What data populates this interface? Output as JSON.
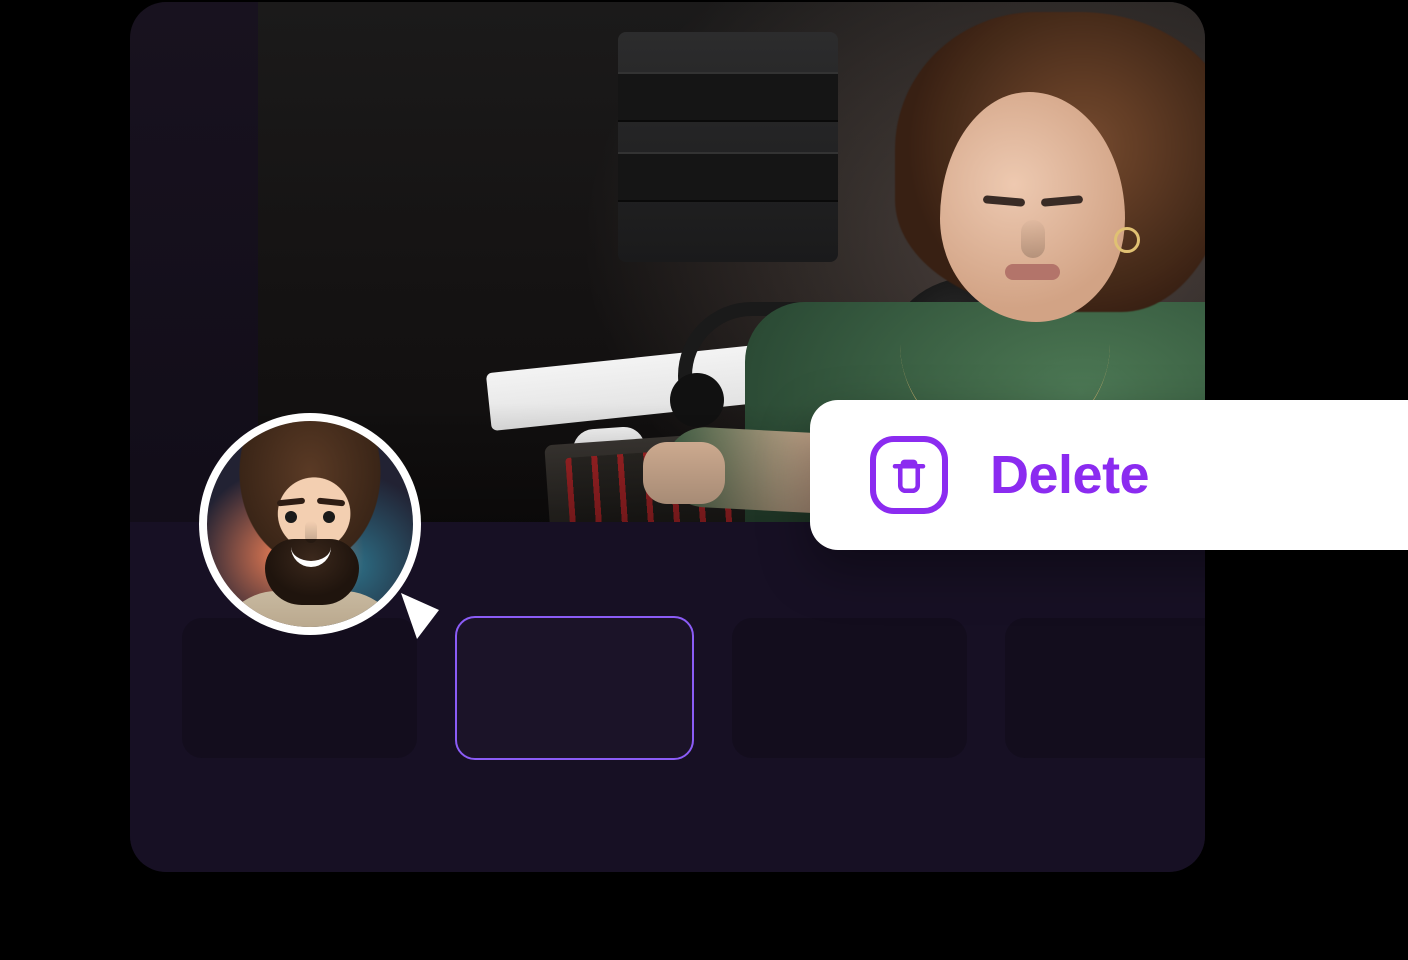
{
  "colors": {
    "accent": "#8b2bf0",
    "card_bg": "#ffffff",
    "panel_bg": "#130d19",
    "timeline_bg": "#171024",
    "thumb_bg": "#130d1d",
    "thumb_selected_border": "#8b5cf6"
  },
  "action": {
    "delete_label": "Delete"
  },
  "semantics": {
    "avatar_alt": "user-avatar",
    "trash_icon_name": "trash-icon",
    "pointer_icon_name": "pointer-triangle"
  },
  "preview": {
    "alt": "podcast-studio-preview"
  },
  "timeline": {
    "items": [
      {
        "selected": false
      },
      {
        "selected": true
      },
      {
        "selected": false
      },
      {
        "selected": false
      }
    ],
    "selected_index": 1
  }
}
